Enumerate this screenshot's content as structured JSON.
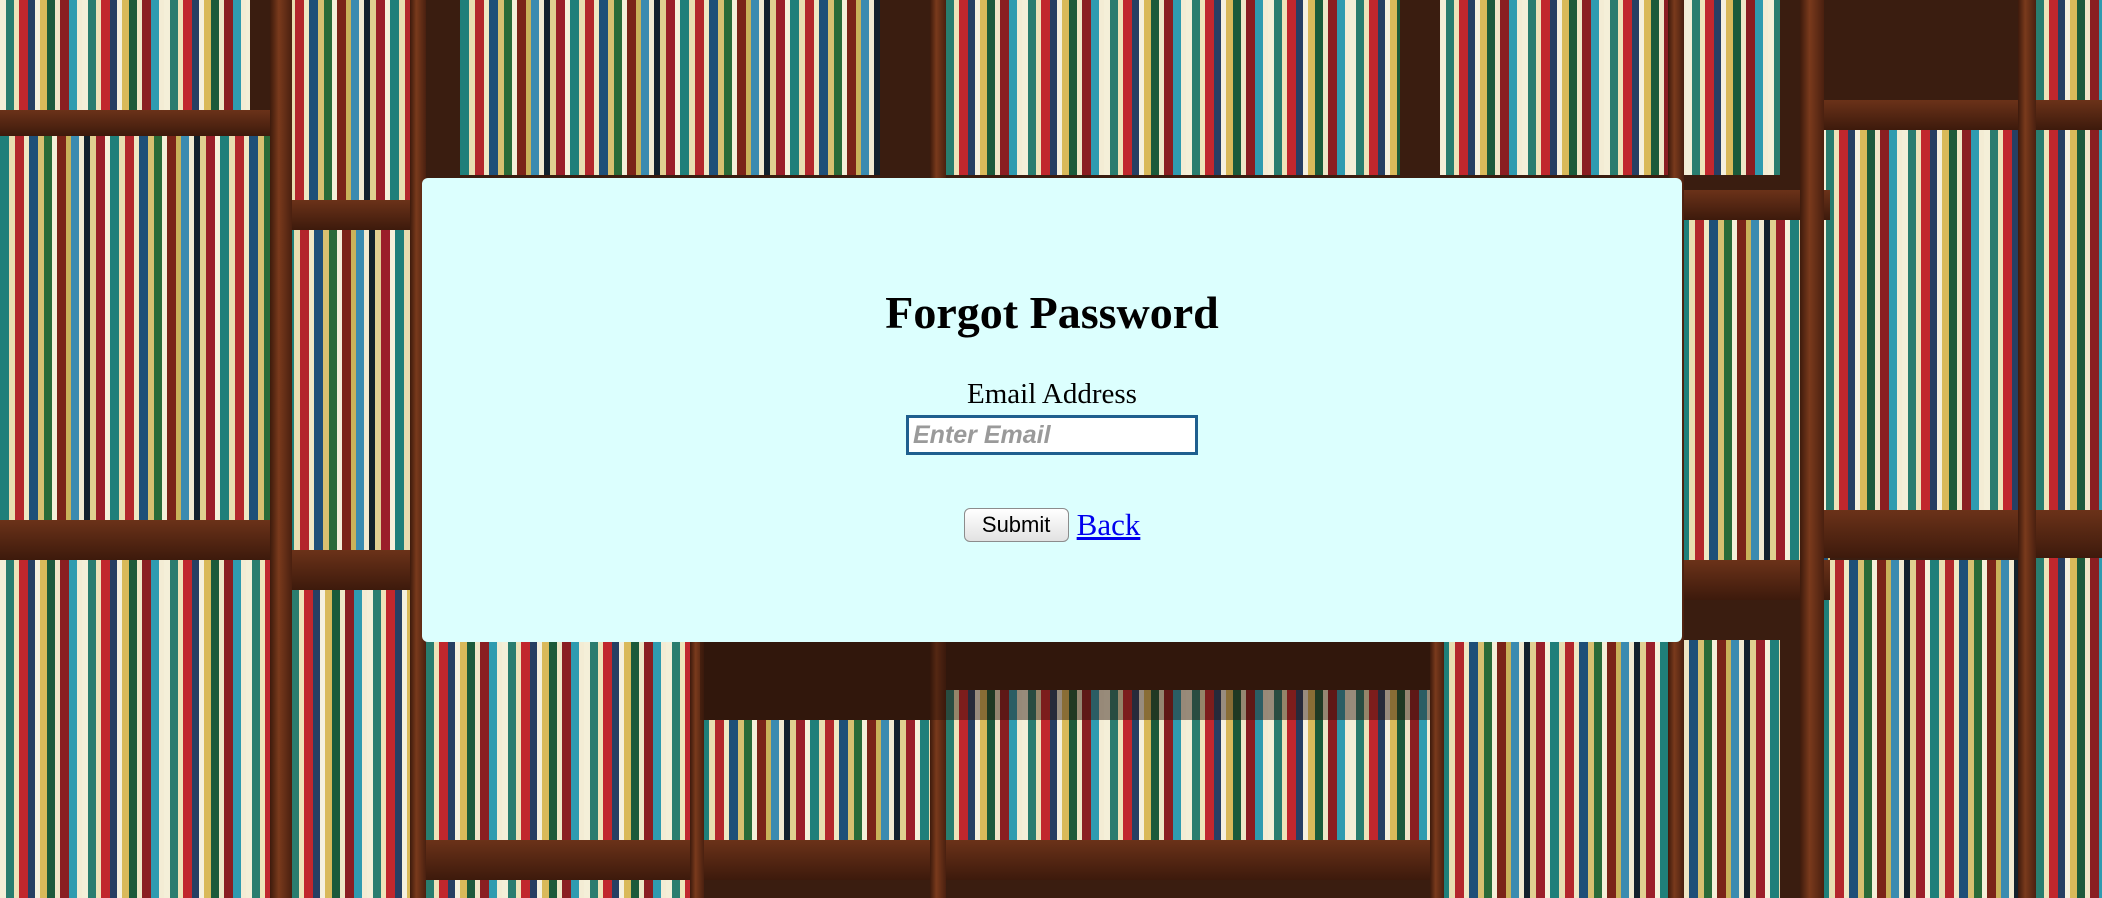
{
  "form": {
    "title": "Forgot Password",
    "email_label": "Email Address",
    "email_placeholder": "Enter Email",
    "email_value": "",
    "submit_label": "Submit",
    "back_label": "Back"
  },
  "colors": {
    "panel_background": "#dcfffe",
    "input_border": "#1f5f8f",
    "link": "#0000ee"
  },
  "background": {
    "scene": "library bookshelves photo"
  }
}
